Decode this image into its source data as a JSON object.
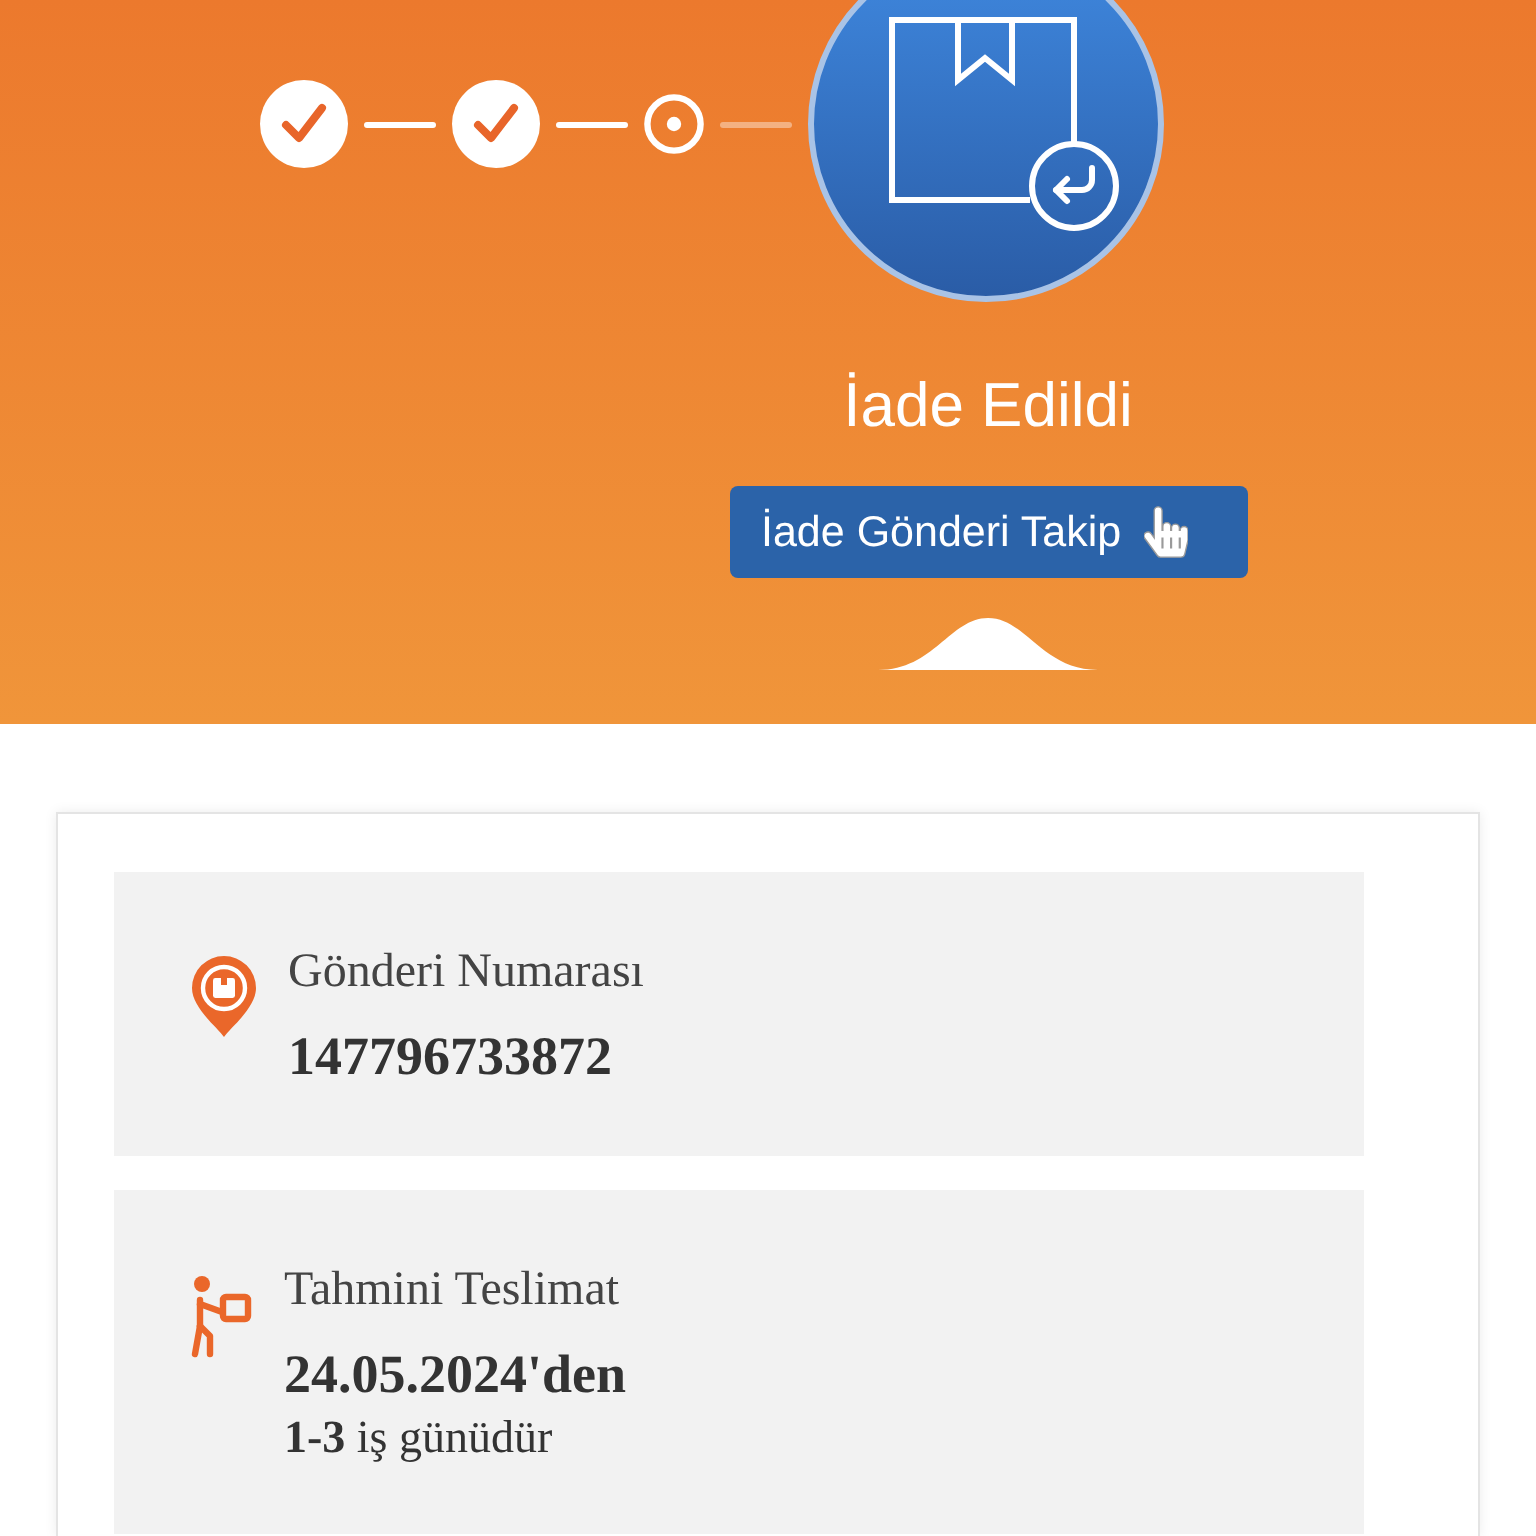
{
  "progress": {
    "steps": [
      {
        "completed": true
      },
      {
        "completed": true
      },
      {
        "completed": false
      }
    ]
  },
  "status": {
    "title": "İade Edildi",
    "button": "İade Gönderi Takip"
  },
  "details": [
    {
      "kind": "shipment-number",
      "label": "Gönderi Numarası",
      "value": "147796733872"
    },
    {
      "kind": "delivery",
      "label": "Tahmini Teslimat",
      "value": "24.05.2024'den",
      "note": "**1-3** iş günüdür"
    }
  ]
}
